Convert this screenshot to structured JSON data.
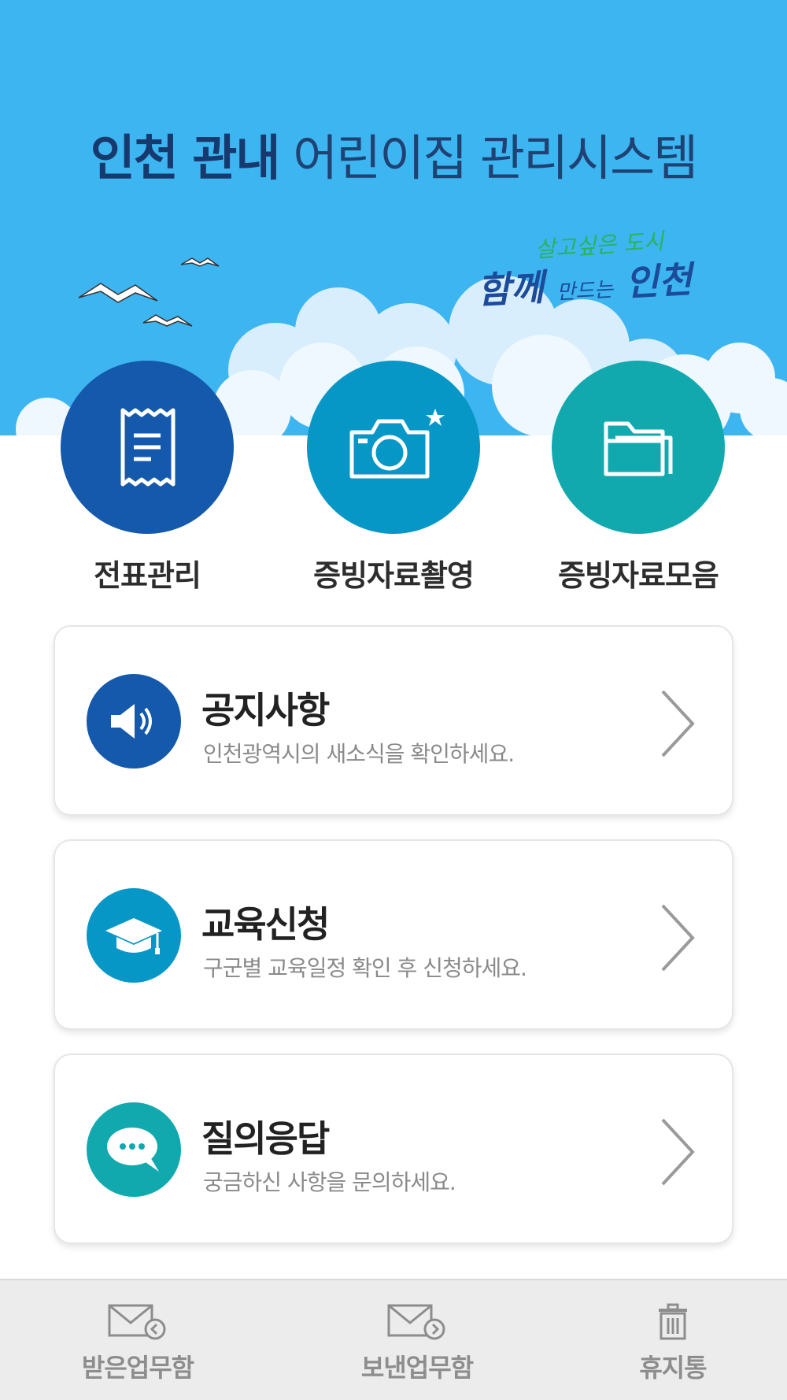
{
  "header": {
    "title_bold": "인천 관내",
    "title_light": "어린이집 관리시스템",
    "slogan_top": "살고싶은 도시",
    "slogan_main_1": "함께",
    "slogan_main_small": "만드는",
    "slogan_main_2": "인천"
  },
  "quick_menu": [
    {
      "label": "전표관리",
      "icon": "receipt-icon",
      "color": "#1459ab"
    },
    {
      "label": "증빙자료촬영",
      "icon": "camera-icon",
      "color": "#0797c7"
    },
    {
      "label": "증빙자료모음",
      "icon": "folder-icon",
      "color": "#11a9ae"
    }
  ],
  "cards": [
    {
      "title": "공지사항",
      "desc": "인천광역시의 새소식을 확인하세요.",
      "icon": "speaker-icon",
      "color": "#1459ab"
    },
    {
      "title": "교육신청",
      "desc": "구군별 교육일정 확인 후 신청하세요.",
      "icon": "graduation-cap-icon",
      "color": "#0797c7"
    },
    {
      "title": "질의응답",
      "desc": "궁금하신 사항을 문의하세요.",
      "icon": "chat-bubble-icon",
      "color": "#11a9ae"
    }
  ],
  "bottom_nav": [
    {
      "label": "받은업무함",
      "icon": "inbox-mail-icon"
    },
    {
      "label": "보낸업무함",
      "icon": "sent-mail-icon"
    },
    {
      "label": "휴지통",
      "icon": "trash-icon"
    }
  ]
}
